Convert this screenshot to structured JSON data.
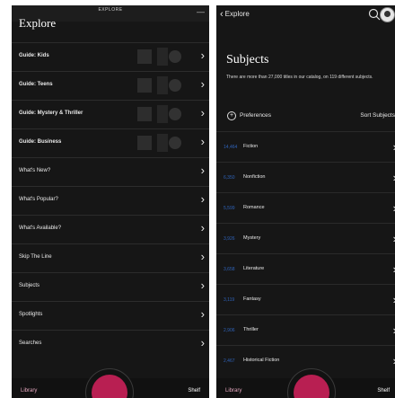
{
  "left": {
    "header_label": "EXPLORE",
    "title": "Explore",
    "rows": [
      {
        "label": "Guide: Kids",
        "bold": true
      },
      {
        "label": "Guide: Teens",
        "bold": true
      },
      {
        "label": "Guide: Mystery & Thriller",
        "bold": true
      },
      {
        "label": "Guide: Business",
        "bold": true
      },
      {
        "label": "What's New?",
        "bold": false
      },
      {
        "label": "What's Popular?",
        "bold": false
      },
      {
        "label": "What's Available?",
        "bold": false
      },
      {
        "label": "Skip The Line",
        "bold": false
      },
      {
        "label": "Subjects",
        "bold": false
      },
      {
        "label": "Spotlights",
        "bold": false
      },
      {
        "label": "Searches",
        "bold": false
      }
    ],
    "tabs": {
      "library": "Library",
      "shelf": "Shelf"
    }
  },
  "right": {
    "back_label": "Explore",
    "title": "Subjects",
    "description": "There are more than 27,000 titles in our catalog, on 119 different subjects.",
    "preferences_label": "Preferences",
    "sort_label": "Sort Subjects",
    "subjects": [
      {
        "count": "14,464",
        "name": "Fiction"
      },
      {
        "count": "6,350",
        "name": "Nonfiction"
      },
      {
        "count": "5,599",
        "name": "Romance"
      },
      {
        "count": "3,926",
        "name": "Mystery"
      },
      {
        "count": "3,658",
        "name": "Literature"
      },
      {
        "count": "3,119",
        "name": "Fantasy"
      },
      {
        "count": "2,906",
        "name": "Thriller"
      },
      {
        "count": "2,467",
        "name": "Historical Fiction"
      }
    ],
    "tabs": {
      "library": "Library",
      "shelf": "Shelf"
    }
  },
  "colors": {
    "background": "#161616",
    "accent": "#b81f52",
    "library_tab": "#e6a8bf",
    "count_blue": "#2f63b9"
  }
}
